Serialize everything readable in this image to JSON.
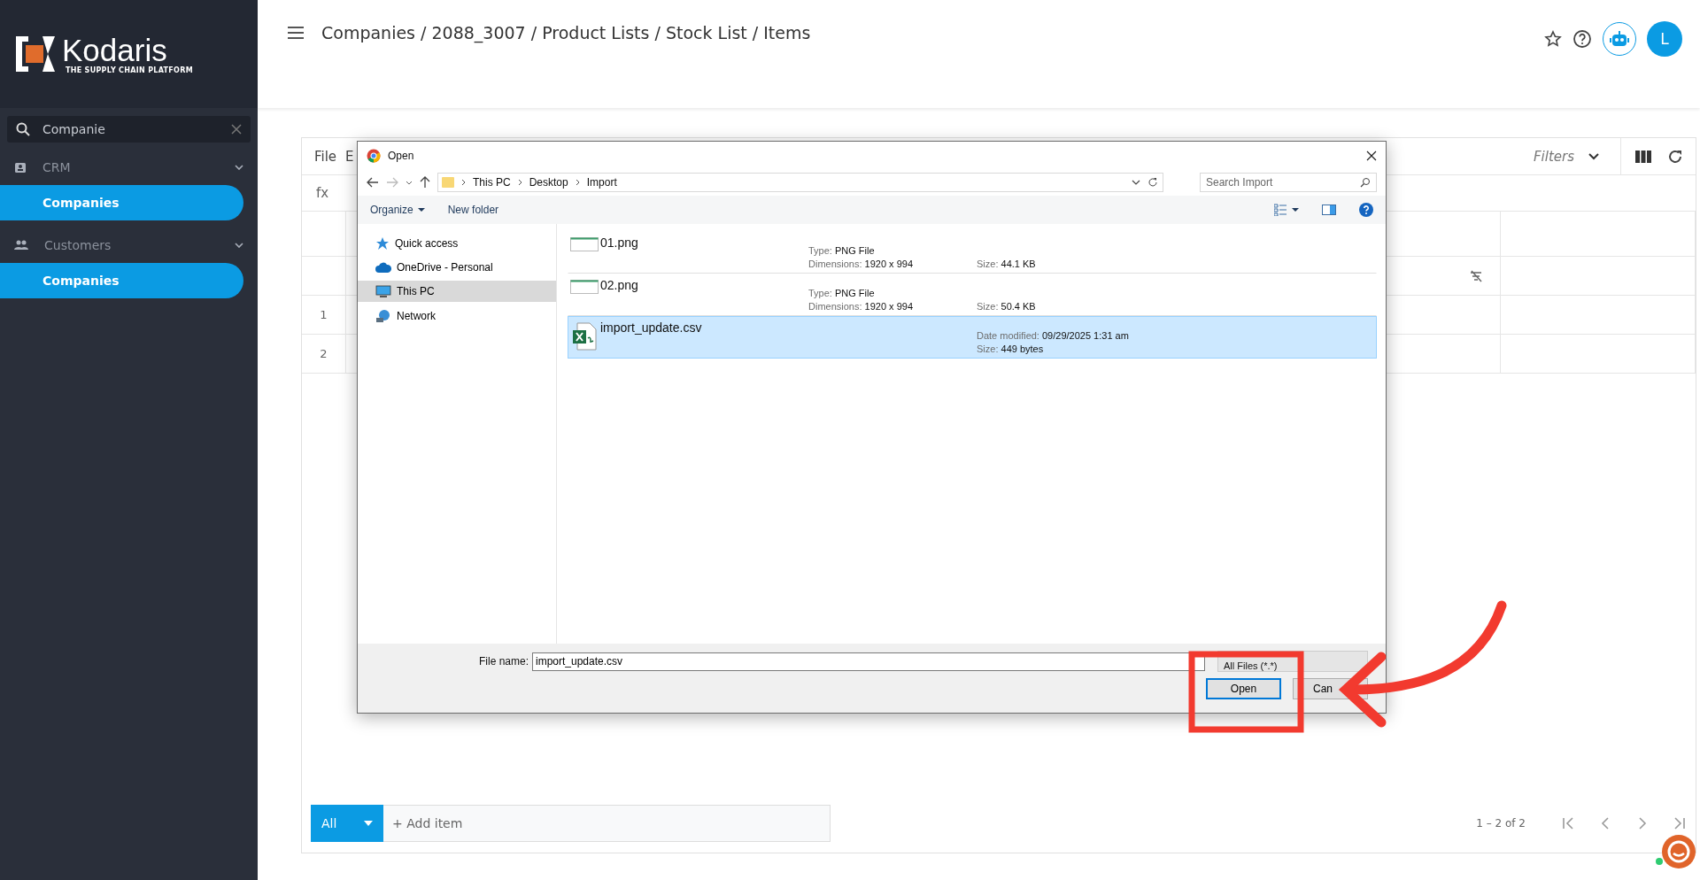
{
  "sidebar": {
    "logo": {
      "name": "Kodaris",
      "tagline": "THE SUPPLY CHAIN PLATFORM"
    },
    "search": {
      "value": "Companie"
    },
    "groups": [
      {
        "label": "CRM",
        "kind": "badge",
        "expanded": true,
        "items": [
          {
            "label": "Companies",
            "selected": true
          }
        ]
      },
      {
        "label": "Customers",
        "kind": "people",
        "expanded": true,
        "items": [
          {
            "label": "Companies",
            "selected": true
          }
        ]
      }
    ]
  },
  "header": {
    "breadcrumb": "Companies / 2088_3007 / Product Lists / Stock List / Items",
    "avatar": "L"
  },
  "grid": {
    "menu": [
      "File",
      "E"
    ],
    "formula_label": "fx",
    "filters": "Filters",
    "row_numbers": [
      "1",
      "2"
    ],
    "footer": {
      "view": "All",
      "add_item": "+ Add item",
      "range": "1 – 2 of 2"
    }
  },
  "dialog": {
    "title": "Open",
    "path": [
      "This PC",
      "Desktop",
      "Import"
    ],
    "search_placeholder": "Search Import",
    "toolbar": [
      "Organize",
      "New folder"
    ],
    "nav": [
      {
        "label": "Quick access",
        "kind": "star",
        "selected": false
      },
      {
        "label": "OneDrive - Personal",
        "kind": "cloud",
        "selected": false
      },
      {
        "label": "This PC",
        "kind": "computer",
        "selected": true
      },
      {
        "label": "Network",
        "kind": "network",
        "selected": false
      }
    ],
    "files": [
      {
        "name": "01.png",
        "kind": "image",
        "selected": false,
        "col_a": [
          {
            "label": "Type:",
            "value": "PNG File"
          },
          {
            "label": "Dimensions:",
            "value": "1920 x 994"
          }
        ],
        "col_b": [
          {
            "label": "Size:",
            "value": "44.1 KB"
          }
        ]
      },
      {
        "name": "02.png",
        "kind": "image",
        "selected": false,
        "col_a": [
          {
            "label": "Type:",
            "value": "PNG File"
          },
          {
            "label": "Dimensions:",
            "value": "1920 x 994"
          }
        ],
        "col_b": [
          {
            "label": "Size:",
            "value": "50.4 KB"
          }
        ]
      },
      {
        "name": "import_update.csv",
        "kind": "spreadsheet",
        "selected": true,
        "col_b": [
          {
            "label": "Date modified:",
            "value": "09/29/2025 1:31 am"
          },
          {
            "label": "Size:",
            "value": "449 bytes"
          }
        ]
      }
    ],
    "file_name_label": "File name:",
    "file_name": "import_update.csv",
    "file_type": "All Files (*.*)",
    "buttons": [
      {
        "label": "Open",
        "default": true
      },
      {
        "label": "Can",
        "default": false
      }
    ]
  }
}
